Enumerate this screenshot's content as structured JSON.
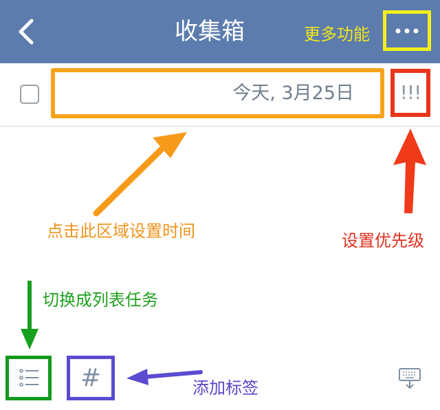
{
  "header": {
    "title": "收集箱",
    "more_label": "更多功能",
    "back_icon": "chevron-left-icon",
    "more_icon": "more-dots-icon",
    "background": "#5b7cad"
  },
  "task": {
    "date": "今天, 3月25日",
    "priority": "!!!"
  },
  "annotations": {
    "set_time": "点击此区域设置时间",
    "set_priority": "设置优先级",
    "switch_list": "切换成列表任务",
    "add_tag": "添加标签"
  },
  "toolbar": {
    "tag_symbol": "#",
    "list_icon": "list-icon",
    "keyboard_icon": "keyboard-hide-icon"
  },
  "colors": {
    "time_highlight": "#f5a31b",
    "priority_highlight": "#e8361c",
    "more_highlight": "#f4ee1c",
    "list_highlight": "#139a1d",
    "tag_highlight": "#5a4bd0"
  }
}
